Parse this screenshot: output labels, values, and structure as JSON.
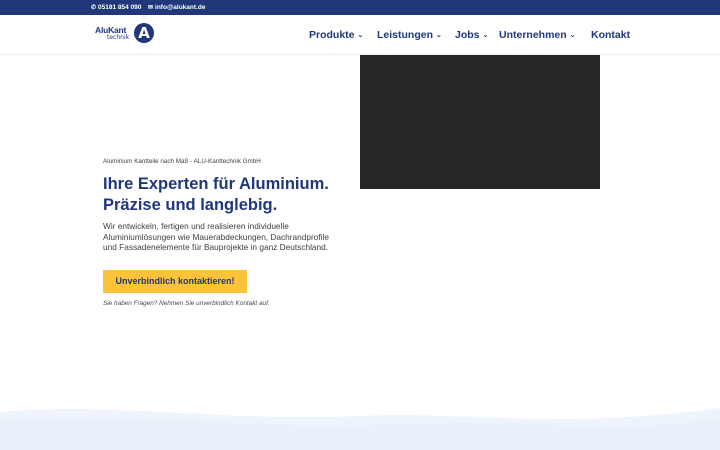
{
  "topbar": {
    "phone": "05181 854 090",
    "email": "info@alukant.de",
    "phone_icon": "phone-icon",
    "email_icon": "envelope-icon"
  },
  "logo": {
    "brand": "AluKant",
    "sub": "technik",
    "mark": "A"
  },
  "nav": {
    "items": [
      {
        "label": "Produkte",
        "dropdown": true
      },
      {
        "label": "Leistungen",
        "dropdown": true
      },
      {
        "label": "Jobs",
        "dropdown": true
      },
      {
        "label": "Unternehmen",
        "dropdown": true
      },
      {
        "label": "Kontakt",
        "dropdown": false
      }
    ]
  },
  "hero": {
    "eyebrow": "Aluminium Kantteile nach Maß - ALU-Kanttechnik GmbH",
    "headline_line1": "Ihre Experten für Aluminium.",
    "headline_line2": "Präzise und langlebig.",
    "lead": "Wir entwickeln, fertigen und realisieren individuelle Aluminiumlösungen wie Mauerabdeckungen, Dachrandprofile und Fassadenelemente für Bauprojekte in ganz Deutschland.",
    "cta_label": "Unverbindlich kontaktieren!",
    "hint": "Sie haben Fragen? Nehmen Sie unverbindlich Kontakt auf."
  },
  "colors": {
    "brand": "#20377a",
    "accent": "#fbc33a",
    "video_bg": "#262626",
    "wave": "#eef4fb"
  }
}
